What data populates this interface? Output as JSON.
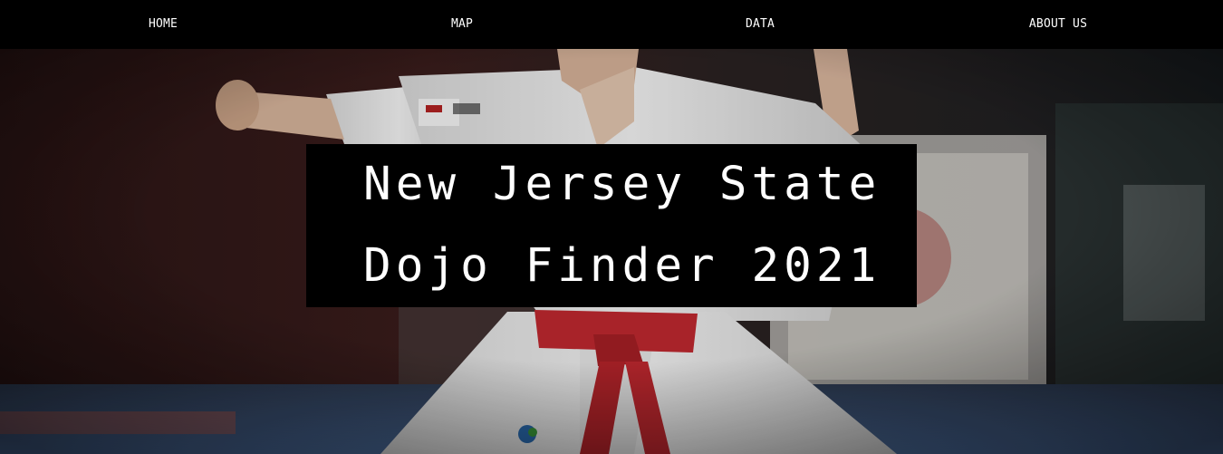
{
  "nav": {
    "items": [
      {
        "label": "HOME"
      },
      {
        "label": "MAP"
      },
      {
        "label": "DATA"
      },
      {
        "label": "ABOUT US"
      }
    ]
  },
  "hero": {
    "title_line1": "New Jersey State",
    "title_line2": "Dojo Finder 2021",
    "image_subject": "karate athlete in white gi with red belt in stance",
    "colors": {
      "belt": "#c0282f",
      "gi": "#f1f1f1",
      "floor": "#3d5a86"
    }
  }
}
